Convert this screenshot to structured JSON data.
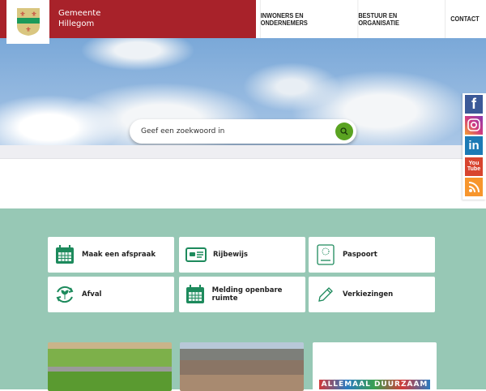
{
  "header": {
    "brand_line1": "Gemeente",
    "brand_line2": "Hillegom",
    "nav": [
      "INWONERS EN ONDERNEMERS",
      "BESTUUR EN ORGANISATIE",
      "CONTACT"
    ]
  },
  "search": {
    "placeholder": "Geef een zoekwoord in"
  },
  "tiles": [
    {
      "label": "Maak een afspraak",
      "icon": "calendar-icon"
    },
    {
      "label": "Rijbewijs",
      "icon": "drivers-license-icon"
    },
    {
      "label": "Paspoort",
      "icon": "passport-icon"
    },
    {
      "label": "Afval",
      "icon": "recycle-icon"
    },
    {
      "label": "Melding openbare ruimte",
      "icon": "calendar-icon"
    },
    {
      "label": "Verkiezingen",
      "icon": "pencil-icon"
    }
  ],
  "cards": {
    "card3_logo_text": "ALLEMAAL DUURZAAM"
  },
  "social": [
    "facebook",
    "instagram",
    "linkedin",
    "youtube",
    "rss"
  ],
  "colors": {
    "brand_red": "#a8222a",
    "accent_green": "#1d8a5c",
    "bg_green": "#97c8b5",
    "search_green": "#5aa321"
  }
}
